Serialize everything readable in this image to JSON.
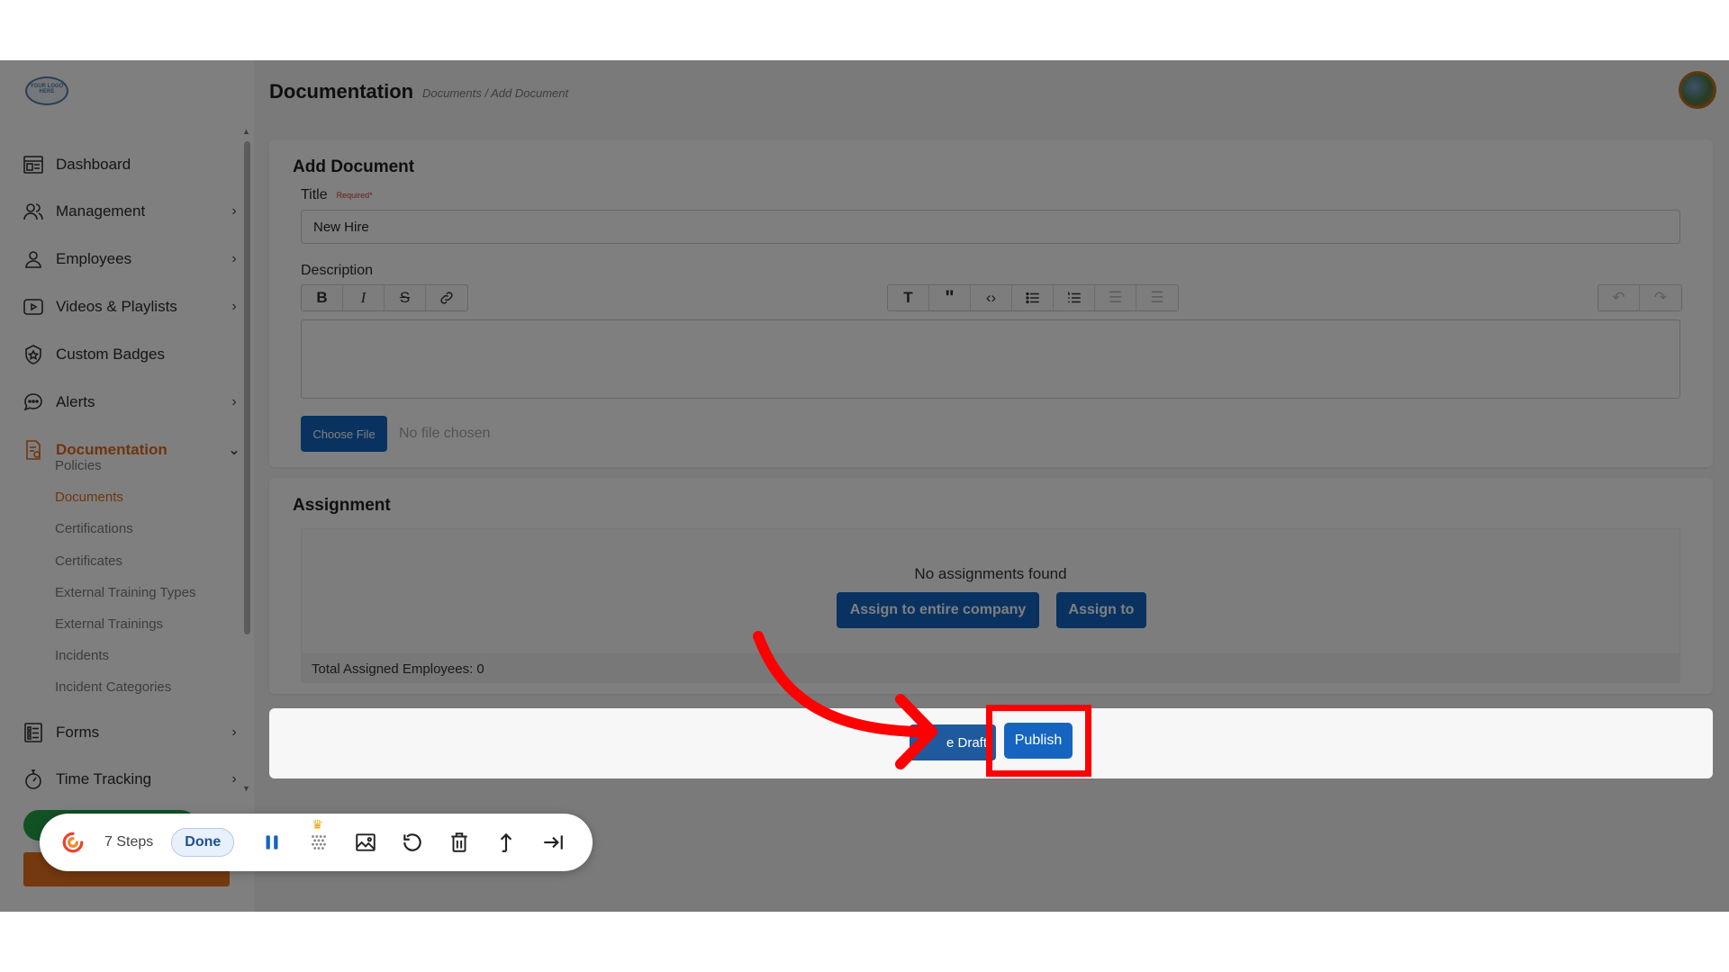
{
  "header": {
    "title": "Documentation",
    "breadcrumb": "Documents / Add Document"
  },
  "logo": {
    "text": "YOUR LOGO HERE"
  },
  "sidebar": {
    "items": [
      {
        "label": "Dashboard",
        "icon": "dashboard-icon",
        "chevron": ""
      },
      {
        "label": "Management",
        "icon": "users-icon",
        "chevron": "›"
      },
      {
        "label": "Employees",
        "icon": "person-icon",
        "chevron": "›"
      },
      {
        "label": "Videos & Playlists",
        "icon": "video-icon",
        "chevron": "›"
      },
      {
        "label": "Custom Badges",
        "icon": "badge-icon",
        "chevron": ""
      },
      {
        "label": "Alerts",
        "icon": "chat-icon",
        "chevron": "›"
      },
      {
        "label": "Documentation",
        "icon": "document-icon",
        "chevron": "⌄"
      },
      {
        "label": "Forms",
        "icon": "list-icon",
        "chevron": "›"
      },
      {
        "label": "Time Tracking",
        "icon": "stopwatch-icon",
        "chevron": "›"
      }
    ],
    "sub_items": [
      "Policies",
      "Documents",
      "Certifications",
      "Certificates",
      "External Training Types",
      "External Trainings",
      "Incidents",
      "Incident Categories"
    ],
    "active_sub": "Documents"
  },
  "add_document": {
    "title": "Add Document",
    "title_label": "Title",
    "required_label": "Required*",
    "title_value": "New Hire",
    "description_label": "Description",
    "choose_file_label": "Choose File",
    "no_file_label": "No file chosen"
  },
  "assignment": {
    "title": "Assignment",
    "empty_text": "No assignments found",
    "assign_company_label": "Assign to entire company",
    "assign_to_label": "Assign to",
    "total_label": "Total Assigned Employees: 0"
  },
  "actions": {
    "draft_label": "e Draft",
    "publish_label": "Publish"
  },
  "recorder": {
    "steps_label": "7 Steps",
    "done_label": "Done"
  },
  "colors": {
    "accent_orange": "#e06a1b",
    "primary_blue": "#1565c0",
    "highlight_red": "#ff0000",
    "green": "#22a54a"
  }
}
